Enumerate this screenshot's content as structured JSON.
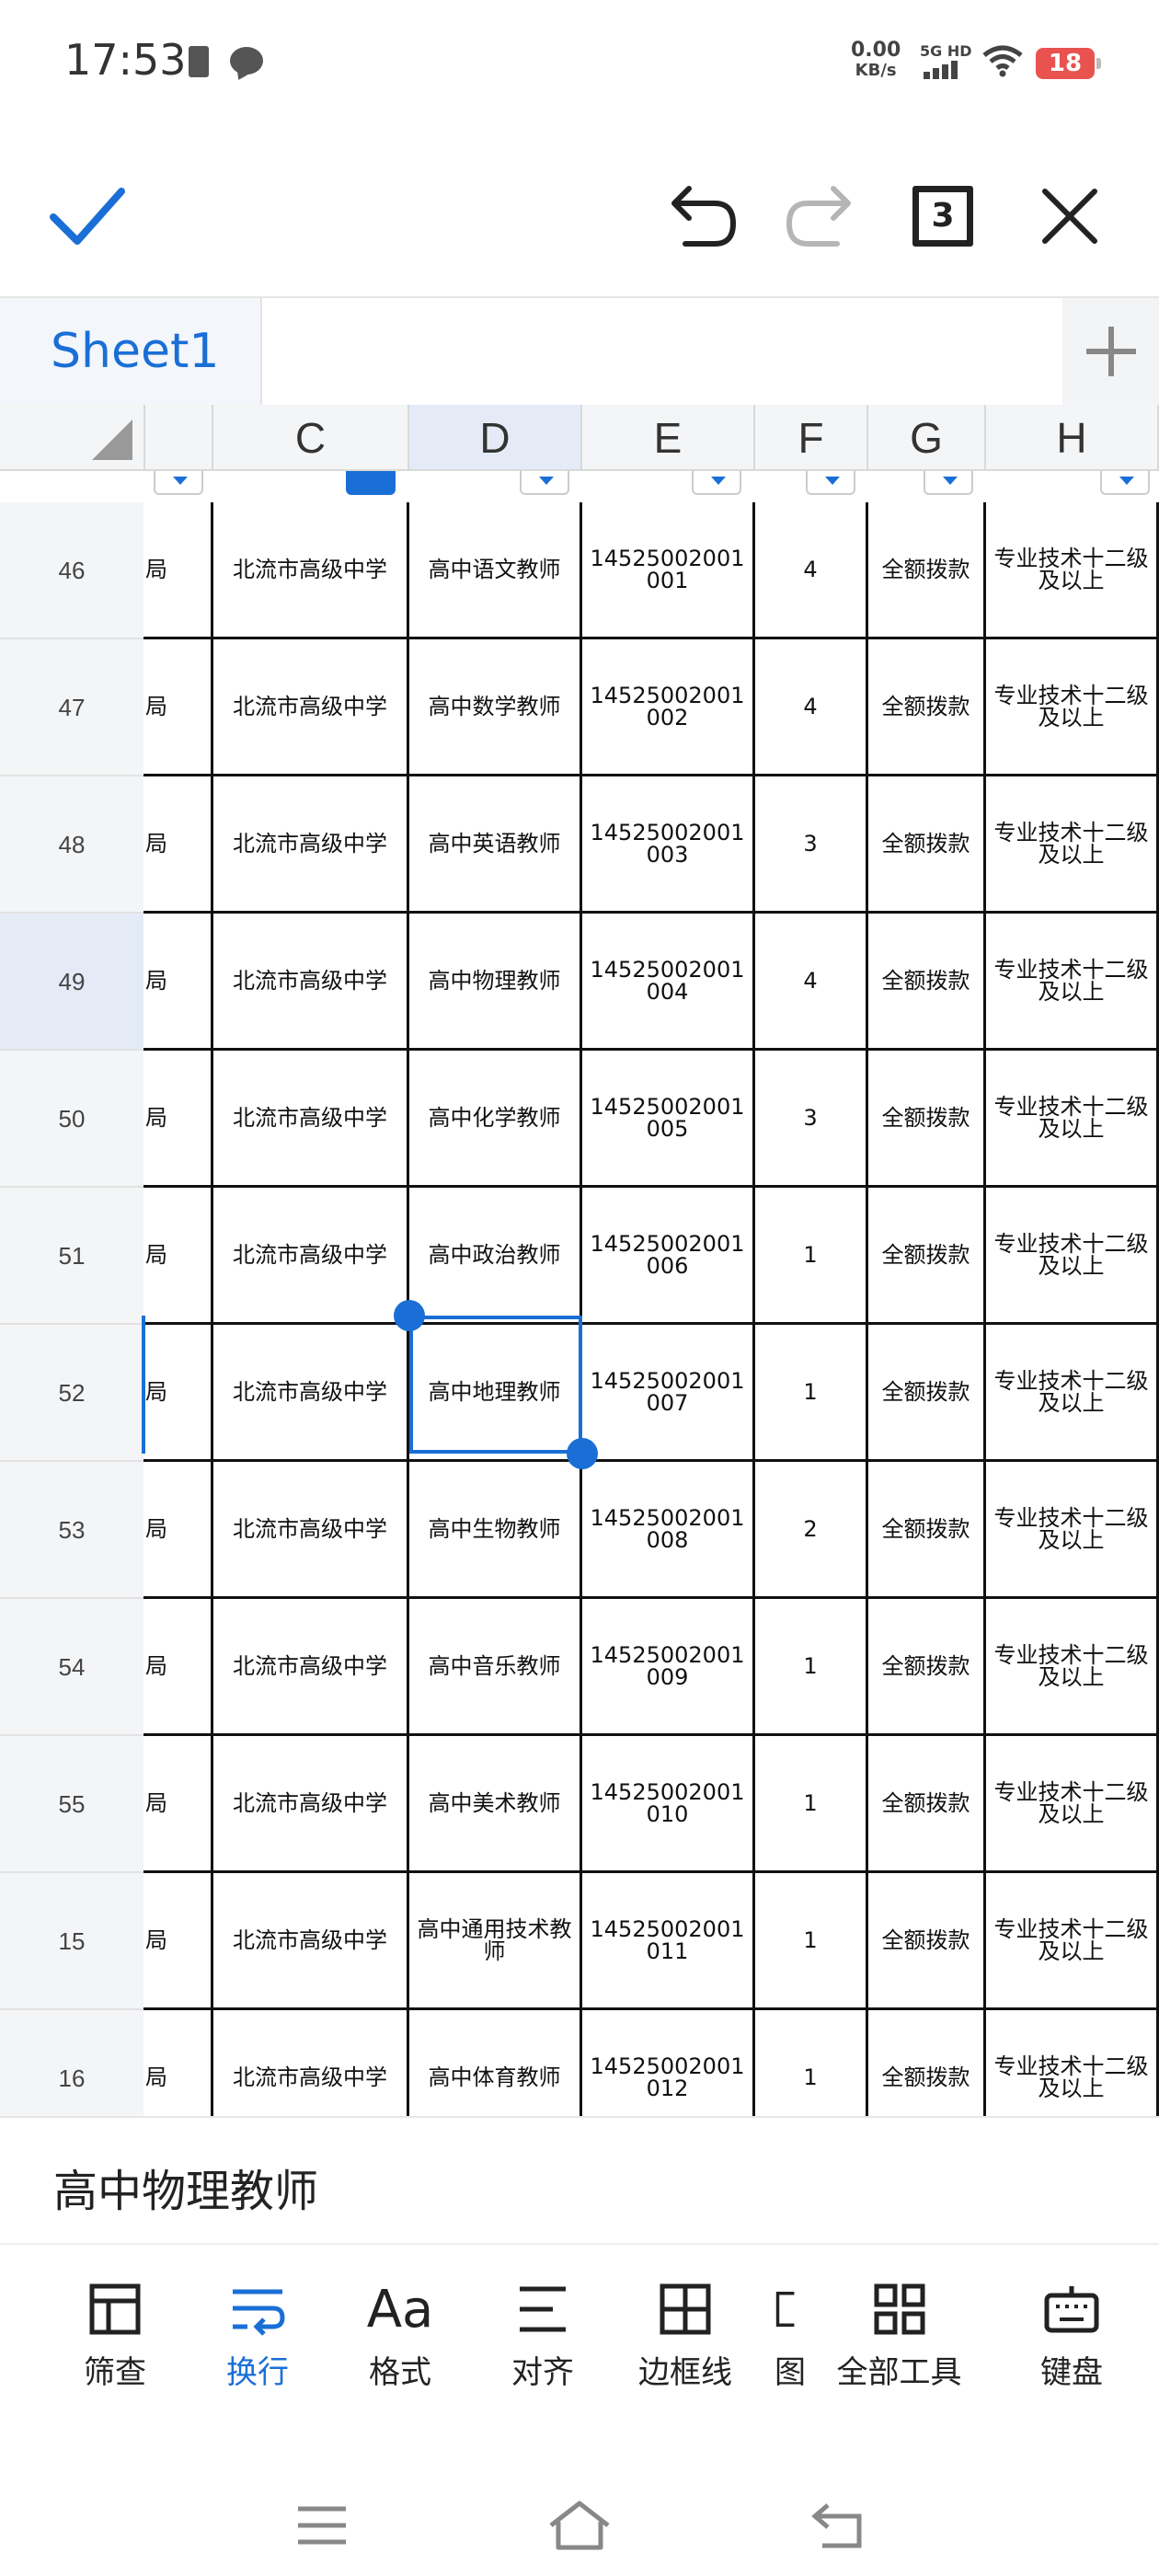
{
  "status": {
    "time": "17:53",
    "net_speed_value": "0.00",
    "net_speed_unit": "KB/s",
    "network": "5G HD",
    "battery": "18"
  },
  "toolbar": {
    "sheet_count": "3"
  },
  "tabs": {
    "active_sheet": "Sheet1"
  },
  "grid": {
    "columns": [
      {
        "id": "b",
        "label": ""
      },
      {
        "id": "c",
        "label": "C"
      },
      {
        "id": "d",
        "label": "D"
      },
      {
        "id": "e",
        "label": "E"
      },
      {
        "id": "f",
        "label": "F"
      },
      {
        "id": "g",
        "label": "G"
      },
      {
        "id": "h",
        "label": "H"
      }
    ],
    "rows": [
      {
        "num": "46",
        "b": "局",
        "c": "北流市高级中学",
        "d": "高中语文教师",
        "e": "14525002001001",
        "f": "4",
        "g": "全额拨款",
        "h": "专业技术十二级及以上"
      },
      {
        "num": "47",
        "b": "局",
        "c": "北流市高级中学",
        "d": "高中数学教师",
        "e": "14525002001002",
        "f": "4",
        "g": "全额拨款",
        "h": "专业技术十二级及以上"
      },
      {
        "num": "48",
        "b": "局",
        "c": "北流市高级中学",
        "d": "高中英语教师",
        "e": "14525002001003",
        "f": "3",
        "g": "全额拨款",
        "h": "专业技术十二级及以上"
      },
      {
        "num": "49",
        "b": "局",
        "c": "北流市高级中学",
        "d": "高中物理教师",
        "e": "14525002001004",
        "f": "4",
        "g": "全额拨款",
        "h": "专业技术十二级及以上"
      },
      {
        "num": "50",
        "b": "局",
        "c": "北流市高级中学",
        "d": "高中化学教师",
        "e": "14525002001005",
        "f": "3",
        "g": "全额拨款",
        "h": "专业技术十二级及以上"
      },
      {
        "num": "51",
        "b": "局",
        "c": "北流市高级中学",
        "d": "高中政治教师",
        "e": "14525002001006",
        "f": "1",
        "g": "全额拨款",
        "h": "专业技术十二级及以上"
      },
      {
        "num": "52",
        "b": "局",
        "c": "北流市高级中学",
        "d": "高中地理教师",
        "e": "14525002001007",
        "f": "1",
        "g": "全额拨款",
        "h": "专业技术十二级及以上"
      },
      {
        "num": "53",
        "b": "局",
        "c": "北流市高级中学",
        "d": "高中生物教师",
        "e": "14525002001008",
        "f": "2",
        "g": "全额拨款",
        "h": "专业技术十二级及以上"
      },
      {
        "num": "54",
        "b": "局",
        "c": "北流市高级中学",
        "d": "高中音乐教师",
        "e": "14525002001009",
        "f": "1",
        "g": "全额拨款",
        "h": "专业技术十二级及以上"
      },
      {
        "num": "55",
        "b": "局",
        "c": "北流市高级中学",
        "d": "高中美术教师",
        "e": "14525002001010",
        "f": "1",
        "g": "全额拨款",
        "h": "专业技术十二级及以上"
      },
      {
        "num": "15",
        "b": "局",
        "c": "北流市高级中学",
        "d": "高中通用技术教师",
        "e": "14525002001011",
        "f": "1",
        "g": "全额拨款",
        "h": "专业技术十二级及以上"
      },
      {
        "num": "16",
        "b": "局",
        "c": "北流市高级中学",
        "d": "高中体育教师",
        "e": "14525002001012",
        "f": "1",
        "g": "全额拨款",
        "h": "专业技术十二级及以上"
      }
    ]
  },
  "formula_bar": {
    "value": "高中物理教师"
  },
  "bottom_tools": [
    {
      "label": "筛查",
      "icon": "filter-table-icon"
    },
    {
      "label": "换行",
      "icon": "wrap-text-icon"
    },
    {
      "label": "格式",
      "icon": "font-format-icon"
    },
    {
      "label": "对齐",
      "icon": "align-icon"
    },
    {
      "label": "边框线",
      "icon": "border-icon"
    },
    {
      "label": "图",
      "icon": "chart-icon"
    },
    {
      "label": "全部工具",
      "icon": "all-tools-icon"
    },
    {
      "label": "键盘",
      "icon": "keyboard-icon"
    }
  ],
  "colors": {
    "accent": "#1a6fd6",
    "selected_header": "#e4ebf7",
    "battery_low": "#e8524f"
  }
}
